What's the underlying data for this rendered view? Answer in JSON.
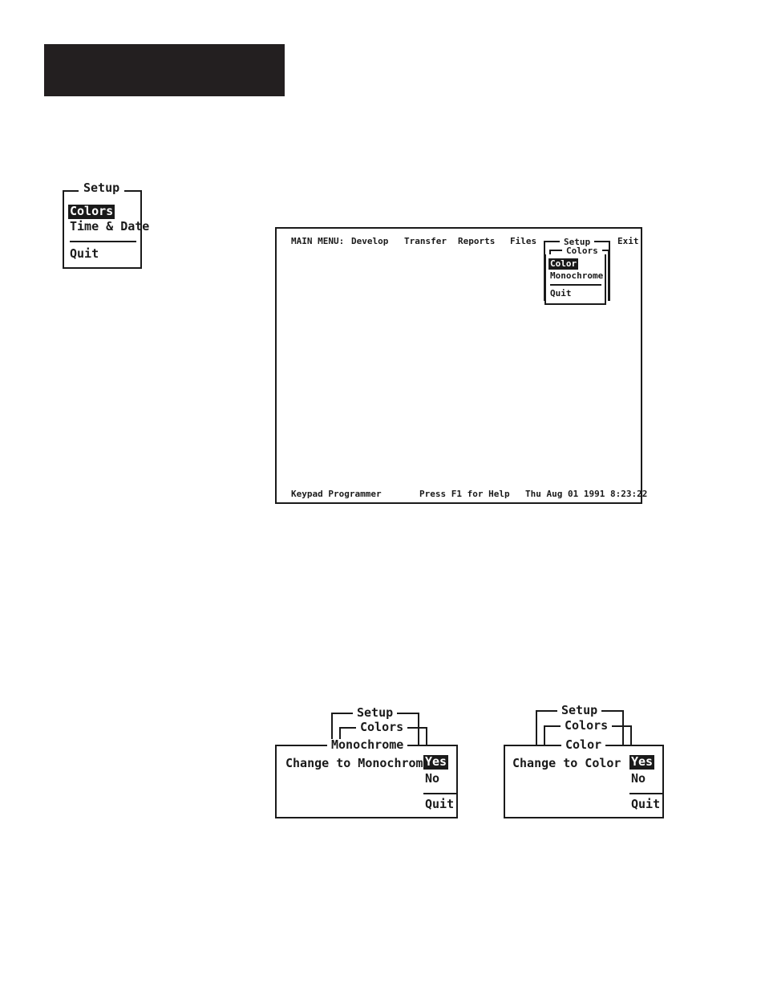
{
  "page": {
    "background_color": "#ffffff",
    "ink_color": "#1a1a1a",
    "header_block_color": "#231f20"
  },
  "setup_menu_standalone": {
    "title": "Setup",
    "items": [
      {
        "label": "Colors",
        "selected": true
      },
      {
        "label": "Time & Date",
        "selected": false
      }
    ],
    "quit_label": "Quit"
  },
  "terminal": {
    "menubar": {
      "prefix": "MAIN MENU:",
      "items": [
        {
          "label": "Develop"
        },
        {
          "label": "Transfer"
        },
        {
          "label": "Reports"
        },
        {
          "label": "Files"
        },
        {
          "label": "Setup"
        },
        {
          "label": "Exit"
        }
      ]
    },
    "breadcrumbs": [
      {
        "label": "Setup"
      },
      {
        "label": "Colors"
      }
    ],
    "colors_dropdown": {
      "items": [
        {
          "label": "Color",
          "selected": true
        },
        {
          "label": "Monochrome",
          "selected": false
        }
      ],
      "quit_label": "Quit"
    },
    "status_bar": {
      "left": "Keypad Programmer",
      "center": "Press F1 for Help",
      "right": "Thu Aug 01 1991  8:23:22"
    }
  },
  "dialog_monochrome": {
    "breadcrumbs": [
      {
        "label": "Setup"
      },
      {
        "label": "Colors"
      }
    ],
    "title": "Monochrome",
    "prompt": "Change to Monochrome ?",
    "options": [
      {
        "label": "Yes",
        "selected": true
      },
      {
        "label": "No",
        "selected": false
      }
    ],
    "quit_label": "Quit"
  },
  "dialog_color": {
    "breadcrumbs": [
      {
        "label": "Setup"
      },
      {
        "label": "Colors"
      }
    ],
    "title": "Color",
    "prompt": "Change to Color ?",
    "options": [
      {
        "label": "Yes",
        "selected": true
      },
      {
        "label": "No",
        "selected": false
      }
    ],
    "quit_label": "Quit"
  }
}
